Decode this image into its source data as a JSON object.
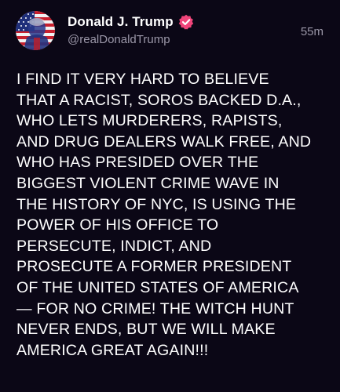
{
  "post": {
    "author": {
      "display_name": "Donald J. Trump",
      "handle": "@realDonaldTrump",
      "avatar_icon": "american-flag-portrait-avatar",
      "verified_icon": "verified-badge-icon"
    },
    "timestamp": "55m",
    "body": "I FIND IT VERY HARD TO BELIEVE\nTHAT A RACIST, SOROS BACKED D.A.,\nWHO LETS MURDERERS, RAPISTS,\nAND DRUG DEALERS WALK FREE, AND\nWHO HAS PRESIDED OVER THE\nBIGGEST VIOLENT CRIME WAVE IN\nTHE HISTORY OF NYC, IS USING THE\nPOWER OF HIS OFFICE TO\nPERSECUTE, INDICT, AND\nPROSECUTE A FORMER PRESIDENT\nOF THE UNITED STATES OF AMERICA\n— FOR NO CRIME! THE WITCH HUNT\nNEVER ENDS, BUT WE WILL MAKE\nAMERICA GREAT AGAIN!!!"
  },
  "colors": {
    "background": "#0b0716",
    "text_primary": "#ffffff",
    "text_secondary": "#9b97a8",
    "verified_badge": "#f0447a"
  }
}
